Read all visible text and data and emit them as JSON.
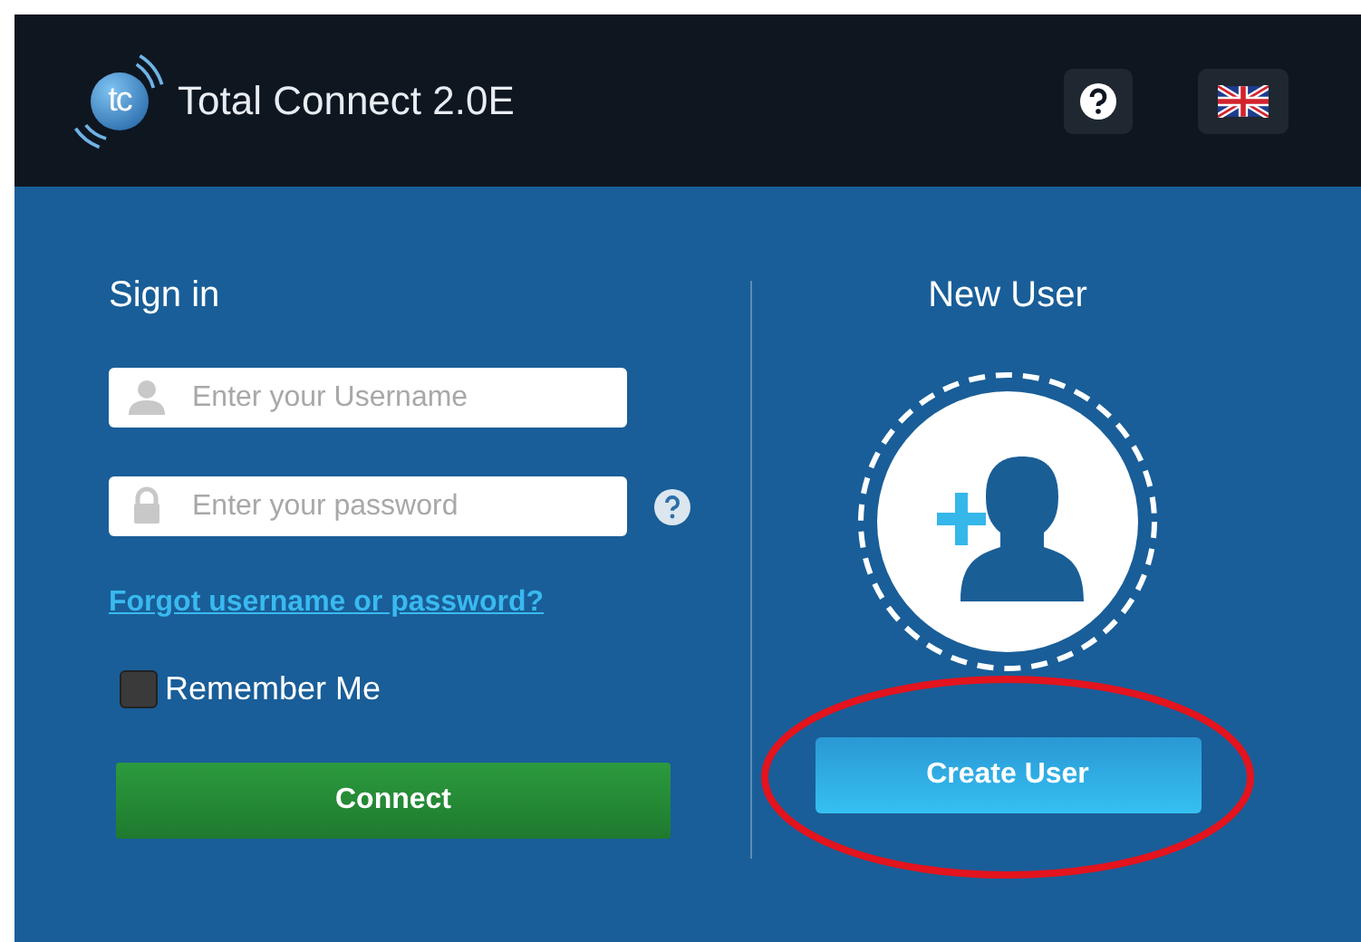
{
  "header": {
    "title": "Total Connect 2.0E",
    "logo_text": "tc"
  },
  "sign_in": {
    "heading": "Sign in",
    "username": {
      "placeholder": "Enter your Username"
    },
    "password": {
      "placeholder": "Enter your password"
    },
    "forgot_link": "Forgot username or password?",
    "remember_me": {
      "label": "Remember Me",
      "checked": false
    },
    "connect_button": "Connect"
  },
  "new_user": {
    "heading": "New User",
    "create_button": "Create User"
  }
}
